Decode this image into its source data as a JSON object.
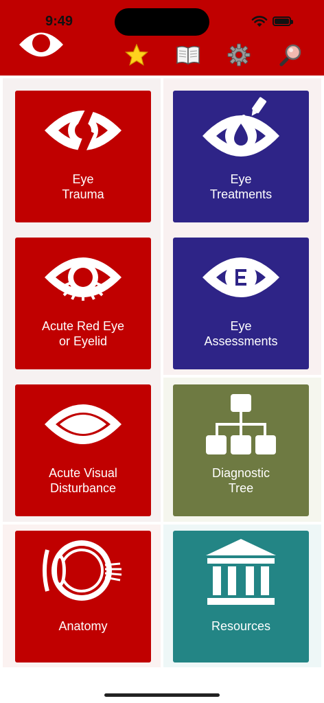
{
  "status_bar": {
    "time": "9:49"
  },
  "toolbar": {
    "items": [
      {
        "icon": "star-icon"
      },
      {
        "icon": "book-icon"
      },
      {
        "icon": "gear-icon"
      },
      {
        "icon": "search-icon"
      }
    ]
  },
  "colors": {
    "header": "#c00000",
    "red_tile": "#c00000",
    "purple_tile": "#2e2487",
    "olive_tile": "#6e7a42",
    "teal_tile": "#238585"
  },
  "tiles": [
    {
      "lines": [
        "Eye",
        "Trauma"
      ]
    },
    {
      "lines": [
        "Eye",
        "Treatments"
      ]
    },
    {
      "lines": [
        "Acute Red Eye",
        "or Eyelid"
      ]
    },
    {
      "lines": [
        "Eye",
        "Assessments"
      ]
    },
    {
      "lines": [
        "Acute Visual",
        "Disturbance"
      ]
    },
    {
      "lines": [
        "Diagnostic",
        "Tree"
      ]
    },
    {
      "lines": [
        "Anatomy"
      ]
    },
    {
      "lines": [
        "Resources"
      ]
    }
  ]
}
